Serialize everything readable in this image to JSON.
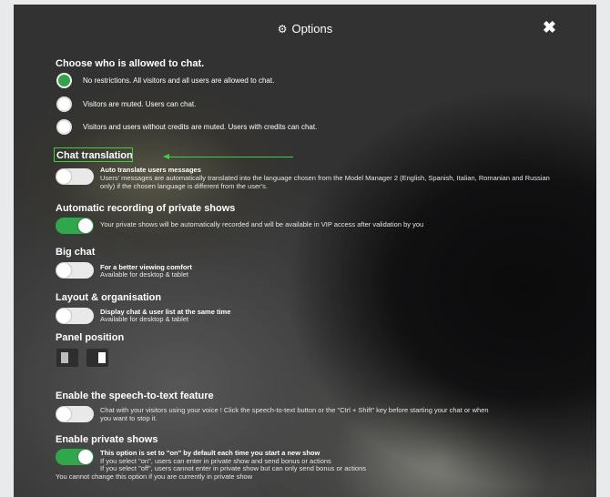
{
  "title": "Options",
  "icons": {
    "title_icon": "gears-icon",
    "close_icon": "close-icon"
  },
  "colors": {
    "accent_green": "#2ea84a",
    "highlight_green": "#3dd23d"
  },
  "chat_permission": {
    "heading": "Choose who is allowed to chat.",
    "options": [
      {
        "label": "No restrictions. All visitors and all users are allowed to chat.",
        "selected": true
      },
      {
        "label": "Visitors are muted. Users can chat.",
        "selected": false
      },
      {
        "label": "Visitors and users without credits are muted. Users with credits can chat.",
        "selected": false
      }
    ]
  },
  "chat_translation": {
    "heading": "Chat translation",
    "enabled": false,
    "title": "Auto translate users messages",
    "description": "Users' messages are automatically translated into the language chosen from the Model Manager 2 (English, Spanish, Italian, Romanian and Russian only) if the chosen language is different from the user's."
  },
  "auto_recording": {
    "heading": "Automatic recording of private shows",
    "enabled": true,
    "description": "Your private shows will be automatically recorded and will be available in VIP access after validation by you"
  },
  "big_chat": {
    "heading": "Big chat",
    "enabled": false,
    "title": "For a better viewing comfort",
    "description": "Available for desktop & tablet"
  },
  "layout": {
    "heading": "Layout & organisation",
    "enabled": false,
    "title": "Display chat & user list at the same time",
    "description": "Available for desktop & tablet"
  },
  "panel_position": {
    "heading": "Panel position",
    "options": [
      "left",
      "right"
    ],
    "selected": "left"
  },
  "speech_to_text": {
    "heading": "Enable the speech-to-text feature",
    "enabled": false,
    "description_line1": "Chat with your visitors using your voice ! Click the speech-to-text button or the \"Ctrl + Shift\" key before starting your chat or when",
    "description_line2": "you want to stop it."
  },
  "private_shows": {
    "heading": "Enable private shows",
    "enabled": true,
    "title": "This option is set to \"on\" by default each time you start a new show",
    "line1": "If you select \"on\", users can enter in private show and send bonus or actions",
    "line2": "If you select \"off\", users cannot enter in private show but can only send bonus or actions",
    "note": "You cannot change this option if you are currently in private show"
  }
}
